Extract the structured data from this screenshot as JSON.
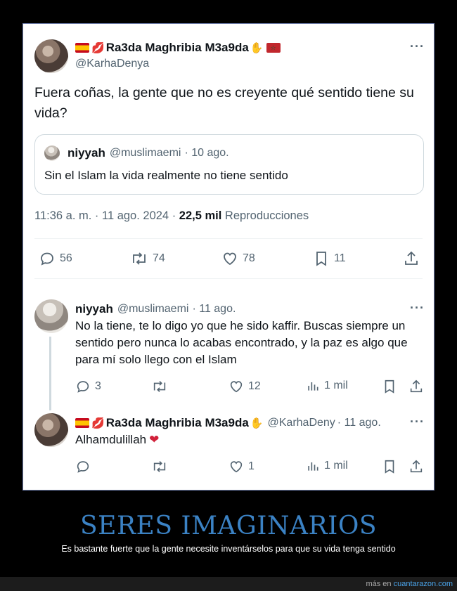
{
  "tweet": {
    "display_name": "Ra3da Maghribia M3a9da",
    "handle": "@KarhaDenya",
    "text": "Fuera coñas, la gente que no es creyente qué sentido tiene su vida?",
    "quote": {
      "display_name": "niyyah",
      "handle": "@muslimaemi",
      "date": "· 10 ago.",
      "text": "Sin el Islam la vida realmente no tiene sentido"
    },
    "time": "11:36 a. m. · 11 ago. 2024 ·",
    "views_count": "22,5 mil",
    "views_label": "Reproducciones",
    "stats": {
      "replies": "56",
      "retweets": "74",
      "likes": "78",
      "bookmarks": "11"
    },
    "more_label": "···"
  },
  "replies": [
    {
      "display_name": "niyyah",
      "handle": "@muslimaemi",
      "date": "· 11 ago.",
      "text": "No la tiene, te lo digo yo que he sido kaffir. Buscas siempre un sentido pero nunca lo acabas encontrado, y la paz es algo que para mí solo llego con el Islam",
      "replies": "3",
      "likes": "12",
      "views": "1 mil"
    },
    {
      "display_name": "Ra3da Maghribia M3a9da",
      "handle": "@KarhaDeny",
      "date": "· 11 ago.",
      "text": "Alhamdulillah",
      "replies": "",
      "likes": "1",
      "views": "1 mil"
    }
  ],
  "caption": {
    "title": "SERES IMAGINARIOS",
    "subtitle": "Es bastante fuerte que la gente necesite inventárselos para que su vida tenga sentido"
  },
  "footer": {
    "prefix": "más en",
    "link": "cuantarazon.com"
  },
  "colors": {
    "accent": "#3b82c4",
    "muted": "#536471",
    "border": "#cfd9de",
    "heart": "#d1213a"
  }
}
